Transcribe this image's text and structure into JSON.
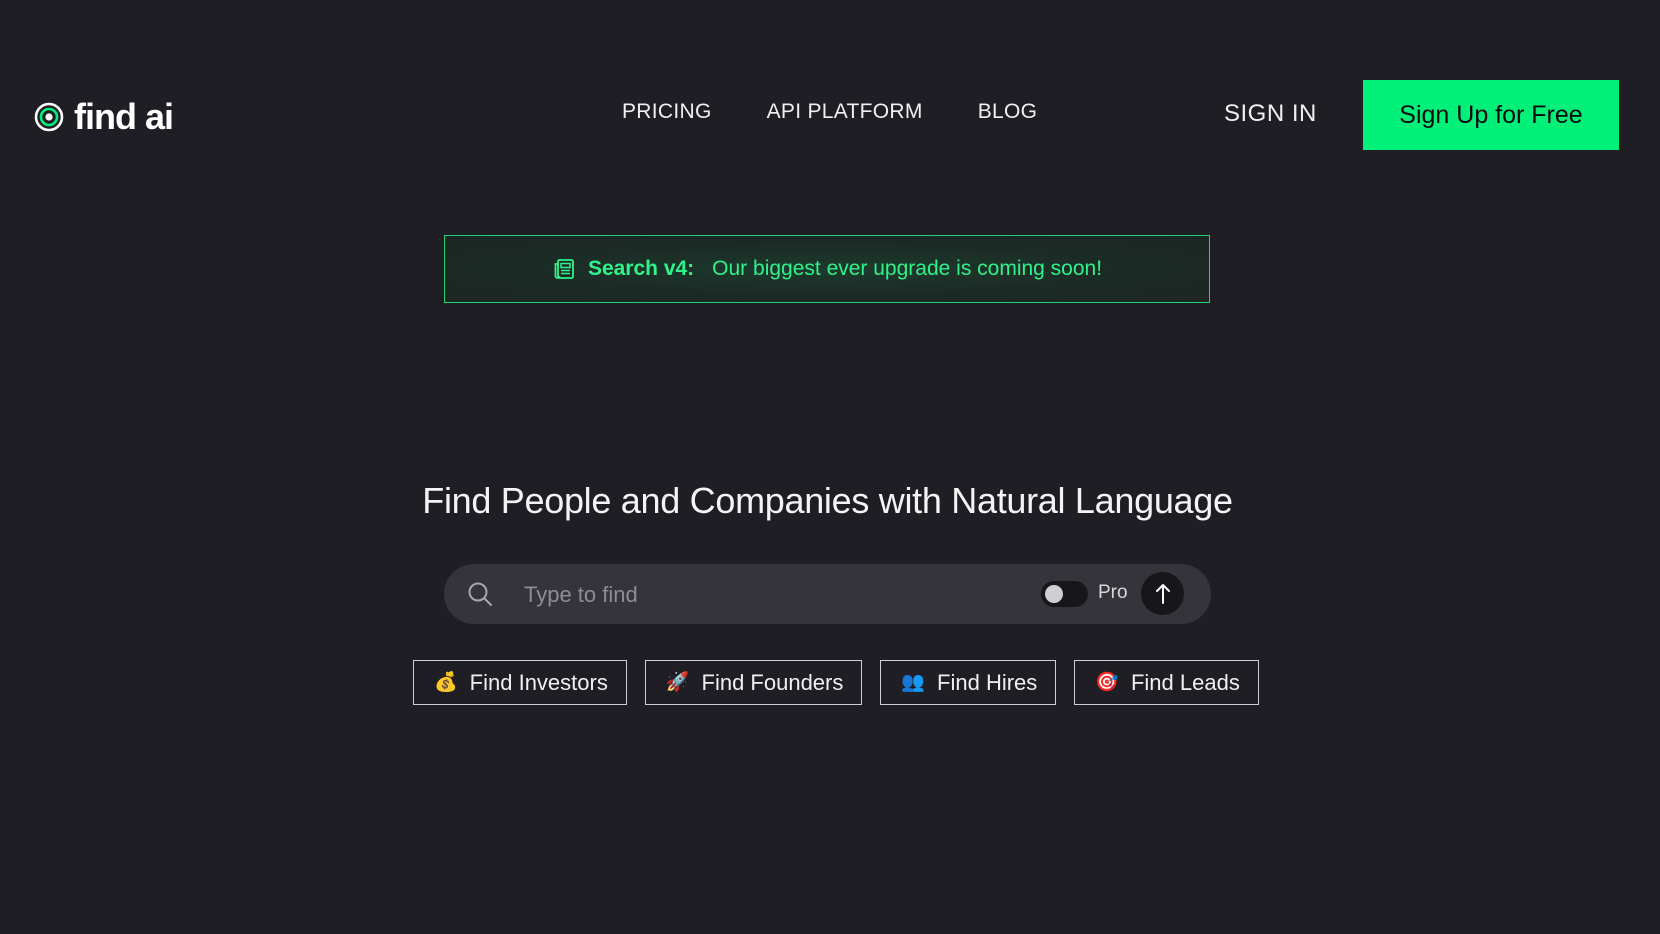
{
  "brand": {
    "name": "find ai",
    "icon": "target-logo-icon"
  },
  "nav": {
    "items": [
      {
        "label": "PRICING"
      },
      {
        "label": "API PLATFORM"
      },
      {
        "label": "BLOG"
      }
    ],
    "sign_in": "SIGN IN",
    "sign_up": "Sign Up for Free"
  },
  "banner": {
    "icon": "newspaper-icon",
    "label": "Search v4:",
    "text": "Our biggest ever upgrade is coming soon!"
  },
  "hero": {
    "headline": "Find People and Companies with Natural Language"
  },
  "search": {
    "placeholder": "Type to find",
    "value": "",
    "pro_label": "Pro",
    "pro_enabled": false,
    "submit_icon": "arrow-up-icon"
  },
  "quick_actions": [
    {
      "emoji": "💰",
      "label": "Find Investors"
    },
    {
      "emoji": "🚀",
      "label": "Find Founders"
    },
    {
      "emoji": "👥",
      "label": "Find Hires"
    },
    {
      "emoji": "🎯",
      "label": "Find Leads"
    }
  ],
  "colors": {
    "background": "#1f1e24",
    "accent": "#00f07a",
    "banner_text": "#2ff28a",
    "search_bg": "#35343a"
  }
}
